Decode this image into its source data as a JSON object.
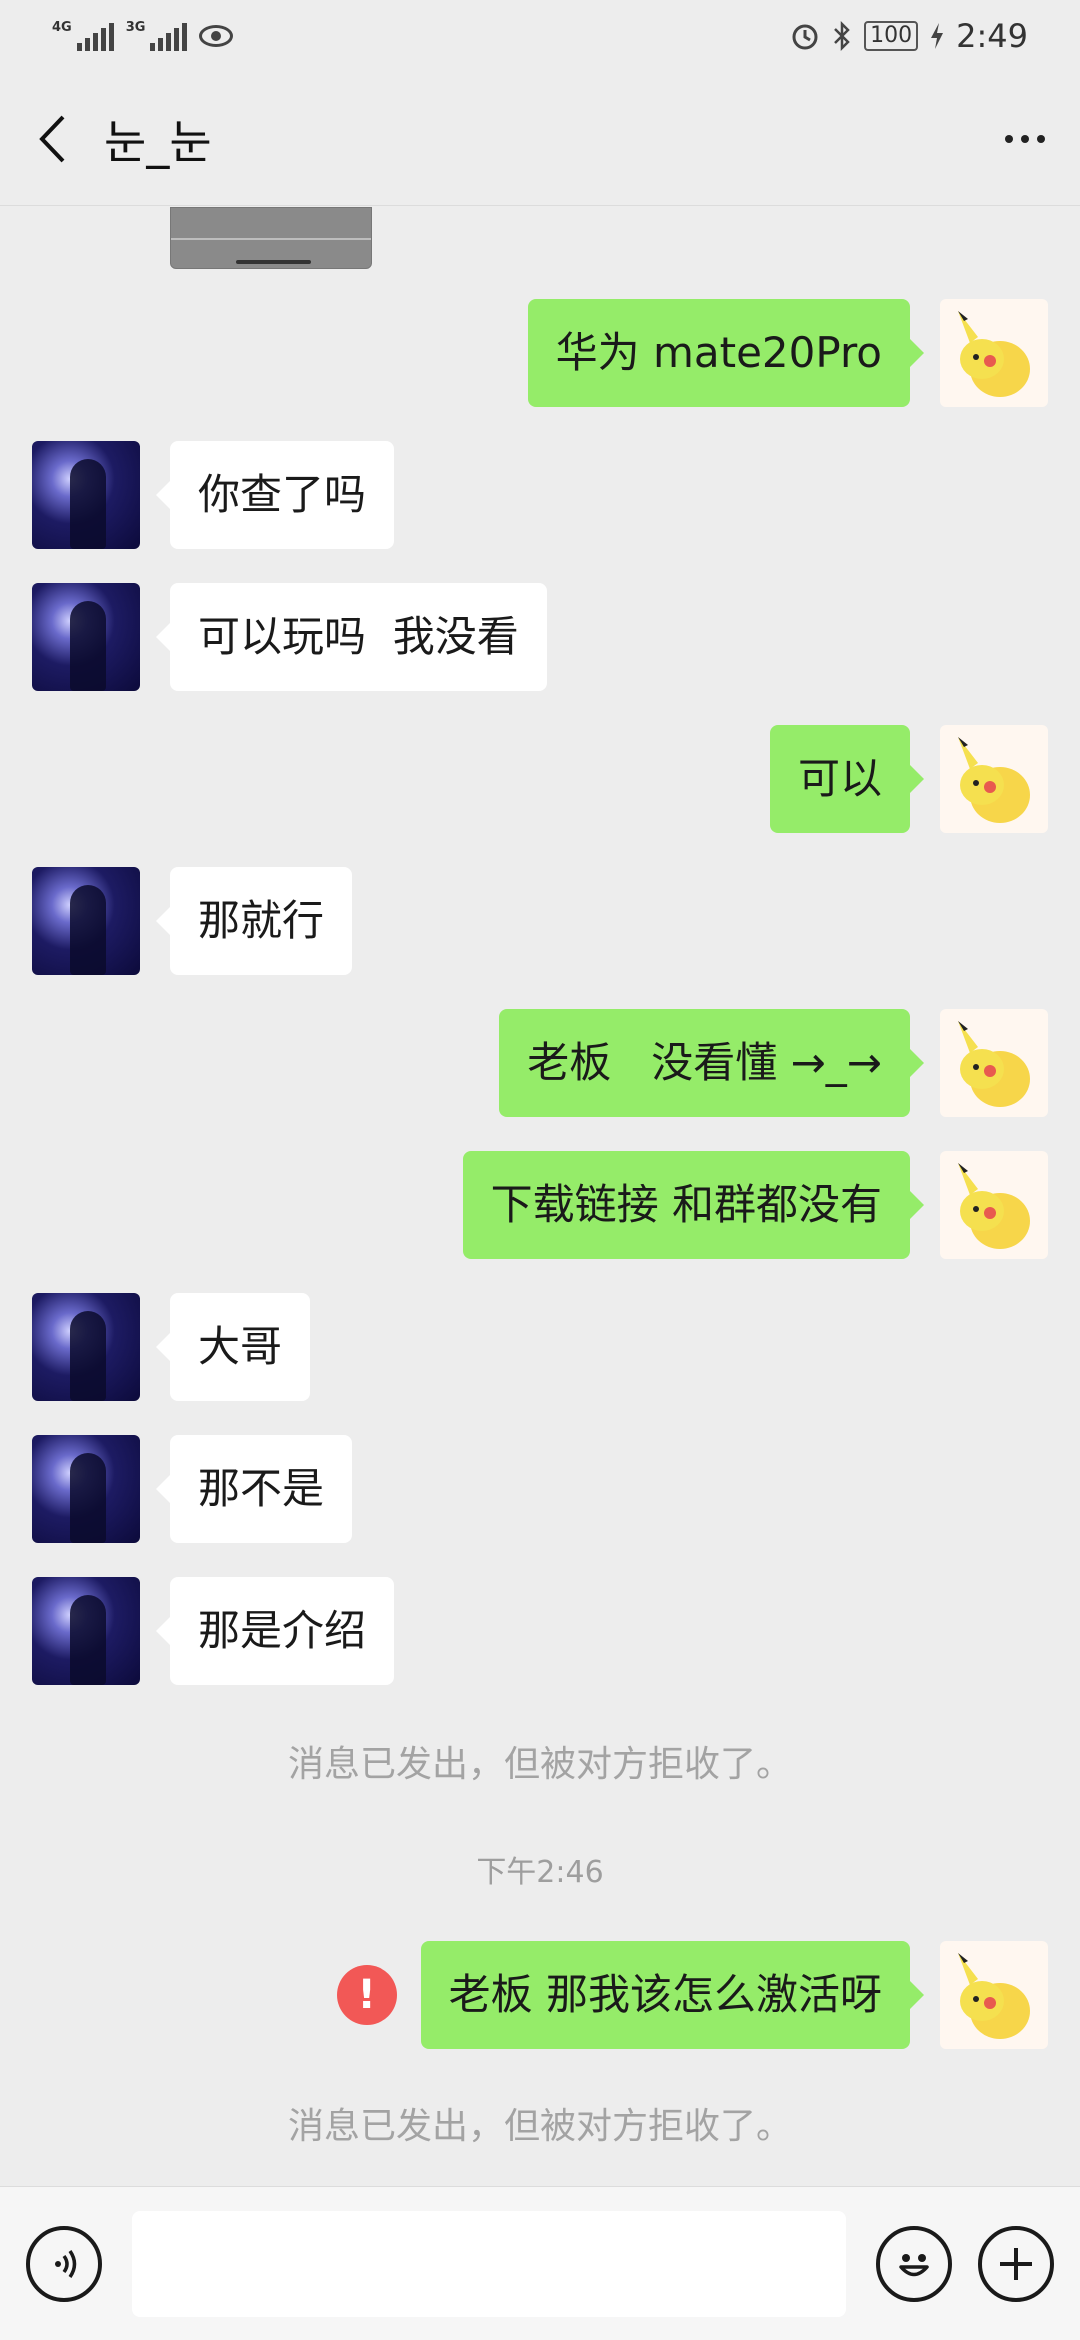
{
  "status_bar": {
    "net1": "4G",
    "net2": "3G",
    "battery": "100",
    "time": "2:49"
  },
  "header": {
    "title": "눈_눈"
  },
  "messages": [
    {
      "side": "out",
      "text": "华为 mate20Pro"
    },
    {
      "side": "in",
      "text": "你查了吗"
    },
    {
      "side": "in",
      "text": "可以玩吗  我没看"
    },
    {
      "side": "out",
      "text": "可以"
    },
    {
      "side": "in",
      "text": "那就行"
    },
    {
      "side": "out",
      "text": "老板   没看懂 →_→"
    },
    {
      "side": "out",
      "text": "下载链接 和群都没有"
    },
    {
      "side": "in",
      "text": "大哥"
    },
    {
      "side": "in",
      "text": "那不是"
    },
    {
      "side": "in",
      "text": "那是介绍"
    }
  ],
  "system": {
    "rejected_1": "消息已发出，但被对方拒收了。",
    "timestamp": "下午2:46",
    "failed_message": "老板 那我该怎么激活呀",
    "rejected_2": "消息已发出，但被对方拒收了。",
    "error_glyph": "!"
  },
  "input": {
    "value": "",
    "placeholder": ""
  },
  "icons": {
    "back": "chevron-left-icon",
    "more": "more-dots-icon",
    "voice": "voice-icon",
    "emoji": "emoji-icon",
    "plus": "plus-icon",
    "error": "error-icon"
  },
  "colors": {
    "outgoing_bubble": "#95ec69",
    "incoming_bubble": "#ffffff",
    "background": "#ededed",
    "error": "#f25856"
  }
}
